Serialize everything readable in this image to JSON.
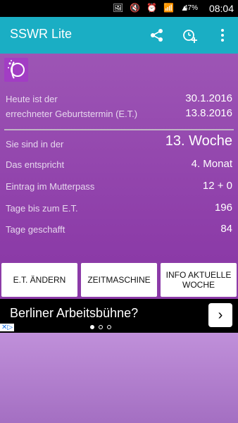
{
  "statusbar": {
    "battery": "47%",
    "time": "08:04"
  },
  "app": {
    "title": "SSWR Lite"
  },
  "info": {
    "today_label": "Heute ist der",
    "today_value": "30.1.2016",
    "due_label": "errechneter Geburtstermin (E.T.)",
    "due_value": "13.8.2016",
    "week_label": "Sie sind in der",
    "week_value": "13. Woche",
    "month_label": "Das entspricht",
    "month_value": "4. Monat",
    "pass_label": "Eintrag im Mutterpass",
    "pass_value": "12 + 0",
    "until_label": "Tage bis zum E.T.",
    "until_value": "196",
    "done_label": "Tage geschafft",
    "done_value": "84"
  },
  "buttons": {
    "change_et": "E.T. ÄNDERN",
    "time_machine": "ZEITMASCHINE",
    "info_week": "INFO AKTUELLE WOCHE"
  },
  "ad": {
    "text": "Berliner Arbeitsbühne?"
  }
}
